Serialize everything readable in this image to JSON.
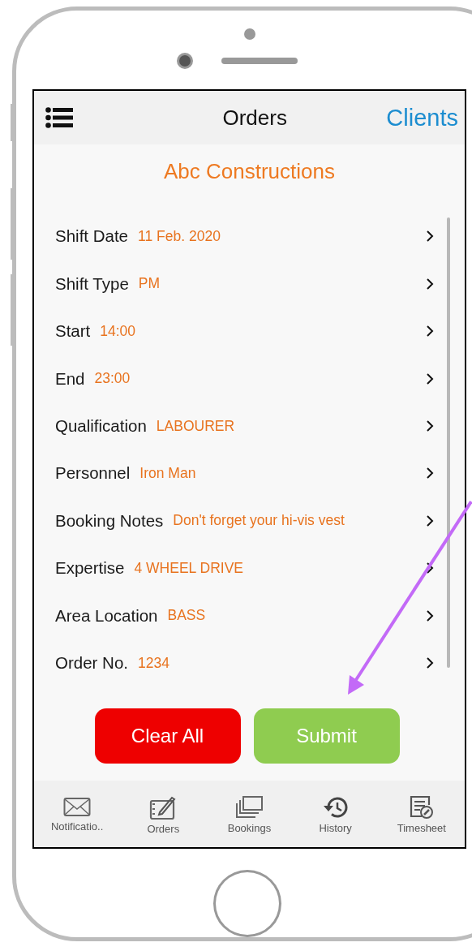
{
  "header": {
    "title": "Orders",
    "action": "Clients"
  },
  "client": "Abc Constructions",
  "fields": [
    {
      "label": "Shift Date",
      "value": "11 Feb. 2020"
    },
    {
      "label": "Shift Type",
      "value": "PM"
    },
    {
      "label": "Start",
      "value": "14:00"
    },
    {
      "label": "End",
      "value": "23:00"
    },
    {
      "label": "Qualification",
      "value": "LABOURER"
    },
    {
      "label": "Personnel",
      "value": "Iron Man"
    },
    {
      "label": "Booking Notes",
      "value": "Don't forget your hi-vis vest"
    },
    {
      "label": "Expertise",
      "value": "4 WHEEL DRIVE"
    },
    {
      "label": "Area Location",
      "value": "BASS"
    },
    {
      "label": "Order No.",
      "value": "1234"
    }
  ],
  "buttons": [
    {
      "label": "Clear All",
      "kind": "danger"
    },
    {
      "label": "Submit",
      "kind": "primary"
    }
  ],
  "tabs": [
    {
      "label": "Notificatio..",
      "kind": "envelope"
    },
    {
      "label": "Orders",
      "kind": "tablet"
    },
    {
      "label": "Bookings",
      "kind": "stack"
    },
    {
      "label": "History",
      "kind": "history"
    },
    {
      "label": "Timesheet",
      "kind": "timesheet"
    }
  ]
}
